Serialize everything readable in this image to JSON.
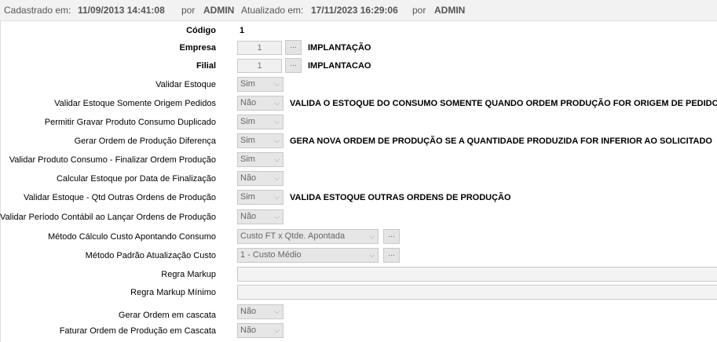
{
  "header": {
    "created_label": "Cadastrado em:",
    "created_value": "11/09/2013 14:41:08",
    "created_by_label": "por",
    "created_by": "ADMIN",
    "updated_label": "Atualizado em:",
    "updated_value": "17/11/2023 16:29:06",
    "updated_by_label": "por",
    "updated_by": "ADMIN"
  },
  "codigo": {
    "label": "Código",
    "value": "1"
  },
  "empresa": {
    "label": "Empresa",
    "number": "1",
    "button": "...",
    "name": "IMPLANTAÇÃO"
  },
  "filial": {
    "label": "Filial",
    "number": "1",
    "button": "...",
    "name": "IMPLANTACAO"
  },
  "fields": {
    "validar_estoque": {
      "label": "Validar Estoque",
      "value": "Sim"
    },
    "validar_estoque_origem": {
      "label": "Validar Estoque Somente Origem Pedidos",
      "value": "Não",
      "desc": "VALIDA O ESTOQUE DO CONSUMO SOMENTE QUANDO ORDEM PRODUÇÃO FOR ORIGEM DE PEDIDOS"
    },
    "permitir_gravar": {
      "label": "Permitir Gravar Produto Consumo Duplicado",
      "value": "Sim"
    },
    "gerar_ordem_diferenca": {
      "label": "Gerar Ordem de Produção Diferença",
      "value": "Sim",
      "desc": "GERA NOVA ORDEM DE PRODUÇÃO SE A QUANTIDADE PRODUZIDA FOR INFERIOR AO SOLICITADO"
    },
    "validar_produto_consumo": {
      "label": "Validar Produto Consumo - Finalizar Ordem Produção",
      "value": "Sim"
    },
    "calcular_estoque": {
      "label": "Calcular Estoque por Data de Finalização",
      "value": "Não"
    },
    "validar_qtd_outras": {
      "label": "Validar Estoque - Qtd Outras Ordens de Produção",
      "value": "Sim",
      "desc": "VALIDA ESTOQUE OUTRAS ORDENS DE PRODUÇÃO"
    },
    "validar_periodo": {
      "label": "Validar Período Contábil ao Lançar Ordens de Produção",
      "value": "Não"
    },
    "metodo_calculo": {
      "label": "Método Cálculo Custo Apontando Consumo",
      "value": "Custo FT x Qtde. Apontada",
      "button": "..."
    },
    "metodo_padrao": {
      "label": "Método Padrão Atualização Custo",
      "value": "1 - Custo Médio",
      "button": "..."
    },
    "regra_markup": {
      "label": "Regra Markup"
    },
    "regra_markup_minimo": {
      "label": "Regra Markup Mínimo"
    },
    "gerar_cascata": {
      "label": "Gerar Ordem em cascata",
      "value": "Não"
    },
    "faturar_cascata": {
      "label": "Faturar Ordem de Produção em Cascata",
      "value": "Não"
    }
  },
  "icons": {
    "dropdown": "chevron-down-icon"
  },
  "colors": {
    "header_bg": "#f2f2f2",
    "field_bg": "#e6e6e6",
    "border": "#c8c8c8"
  }
}
